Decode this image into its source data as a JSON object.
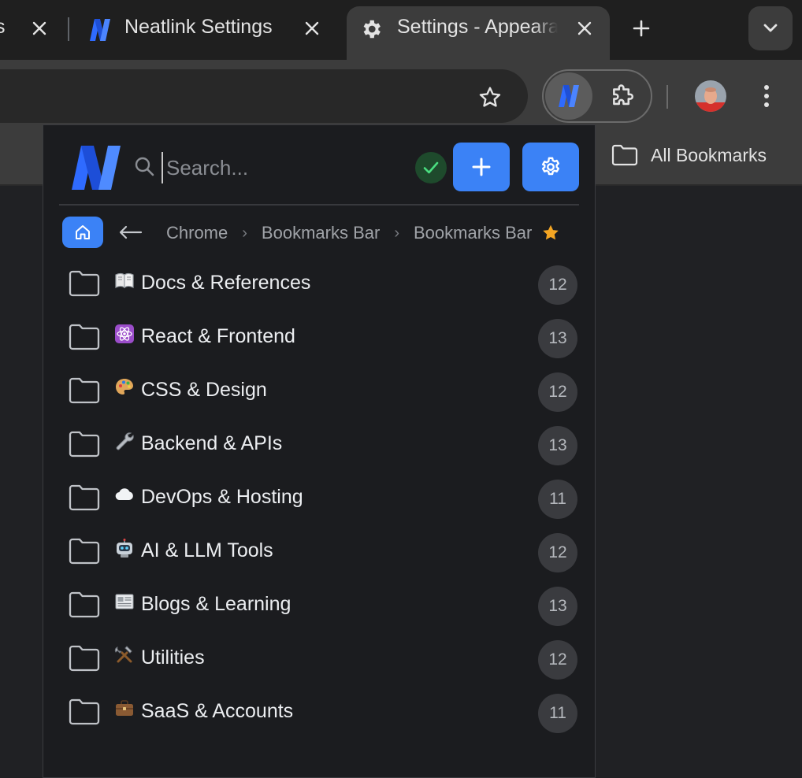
{
  "tabs": [
    {
      "title": "s",
      "close_label": "×"
    },
    {
      "title": "Neatlink Settings",
      "close_label": "×"
    },
    {
      "title": "Settings - Appeara",
      "close_label": "×"
    }
  ],
  "new_tab_label": "+",
  "bookmarks_bar": {
    "all_bookmarks_label": "All Bookmarks"
  },
  "popup": {
    "search": {
      "placeholder": "Search..."
    },
    "breadcrumb": [
      "Chrome",
      "Bookmarks Bar",
      "Bookmarks Bar"
    ],
    "breadcrumb_separator": "›",
    "folders": [
      {
        "emoji_icon": "book-icon",
        "label": "Docs & References",
        "count": "12"
      },
      {
        "emoji_icon": "atom-icon",
        "label": "React & Frontend",
        "count": "13"
      },
      {
        "emoji_icon": "palette-icon",
        "label": "CSS & Design",
        "count": "12"
      },
      {
        "emoji_icon": "wrench-icon",
        "label": "Backend & APIs",
        "count": "13"
      },
      {
        "emoji_icon": "cloud-icon",
        "label": "DevOps & Hosting",
        "count": "11"
      },
      {
        "emoji_icon": "robot-icon",
        "label": "AI & LLM Tools",
        "count": "12"
      },
      {
        "emoji_icon": "newspaper-icon",
        "label": "Blogs & Learning",
        "count": "13"
      },
      {
        "emoji_icon": "tools-icon",
        "label": "Utilities",
        "count": "12"
      },
      {
        "emoji_icon": "briefcase-icon",
        "label": "SaaS & Accounts",
        "count": "11"
      }
    ]
  },
  "colors": {
    "accent": "#3b82f6",
    "popup_bg": "#1b1c1f",
    "chrome_dark": "#1f1f1f",
    "chrome_toolbar": "#3c3c3c",
    "status_green": "#4ade80",
    "star": "#f5a623"
  }
}
